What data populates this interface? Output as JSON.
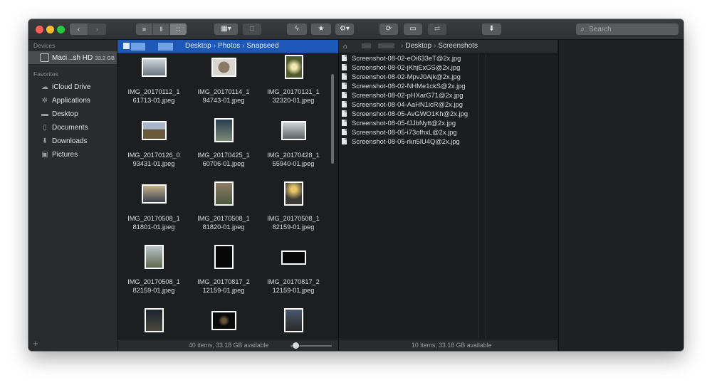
{
  "colors": {
    "close": "#fc5f57",
    "minimize": "#fdbc2e",
    "zoom": "#28c840",
    "path_bar_active": "#1d57b8"
  },
  "toolbar": {
    "back_icon": "chevron-left-icon",
    "forward_icon": "chevron-right-icon",
    "view_modes": [
      "list-view-icon",
      "column-view-icon",
      "icon-view-icon"
    ],
    "active_view": "icon-view-icon",
    "icons": [
      "arrange-icon",
      "get-info-icon",
      "quick-action-icon",
      "favorite-star-icon",
      "gear-icon",
      "refresh-icon",
      "terminal-icon",
      "compare-icon",
      "download-icon"
    ],
    "search_placeholder": "Search"
  },
  "sidebar": {
    "devices_heading": "Devices",
    "device": {
      "name": "Maci...sh HD",
      "capacity": "33.2 GB"
    },
    "favorites_heading": "Favorites",
    "favorites": [
      {
        "label": "iCloud Drive",
        "icon": "cloud-icon"
      },
      {
        "label": "Applications",
        "icon": "applications-icon"
      },
      {
        "label": "Desktop",
        "icon": "desktop-icon"
      },
      {
        "label": "Documents",
        "icon": "document-icon"
      },
      {
        "label": "Downloads",
        "icon": "download-icon"
      },
      {
        "label": "Pictures",
        "icon": "camera-icon"
      }
    ],
    "add_label": "+"
  },
  "pane_left": {
    "breadcrumbs": [
      "Desktop",
      "Photos",
      "Snapseed"
    ],
    "files": [
      {
        "line1": "IMG_20170112_1",
        "line2": "61713-01.jpeg"
      },
      {
        "line1": "IMG_20170114_1",
        "line2": "94743-01.jpeg"
      },
      {
        "line1": "IMG_20170121_1",
        "line2": "32320-01.jpeg"
      },
      {
        "line1": "IMG_20170126_0",
        "line2": "93431-01.jpeg"
      },
      {
        "line1": "IMG_20170425_1",
        "line2": "60706-01.jpeg"
      },
      {
        "line1": "IMG_20170428_1",
        "line2": "55940-01.jpeg"
      },
      {
        "line1": "IMG_20170508_1",
        "line2": "81801-01.jpeg"
      },
      {
        "line1": "IMG_20170508_1",
        "line2": "81820-01.jpeg"
      },
      {
        "line1": "IMG_20170508_1",
        "line2": "82159-01.jpeg"
      },
      {
        "line1": "IMG_20170508_1",
        "line2": "82159-01.jpeg"
      },
      {
        "line1": "IMG_20170817_2",
        "line2": "12159-01.jpeg"
      },
      {
        "line1": "IMG_20170817_2",
        "line2": "12159-01.jpeg"
      },
      {
        "line1": "",
        "line2": ""
      },
      {
        "line1": "",
        "line2": ""
      },
      {
        "line1": "",
        "line2": ""
      }
    ],
    "status": "40 items, 33.18 GB available"
  },
  "pane_right": {
    "breadcrumbs": [
      "Desktop",
      "Screenshots"
    ],
    "files": [
      "Screenshot-08-02-eOi633eT@2x.jpg",
      "Screenshot-08-02-jKhjExGS@2x.jpg",
      "Screenshot-08-02-MpvJ0Ajk@2x.jpg",
      "Screenshot-08-02-NHMe1ckS@2x.jpg",
      "Screenshot-08-02-pHXarG71@2x.jpg",
      "Screenshot-08-04-AaHN1icR@2x.jpg",
      "Screenshot-08-05-AvGWO1Kh@2x.jpg",
      "Screenshot-08-05-fJJbNytt@2x.jpg",
      "Screenshot-08-05-i73ofhxL@2x.jpg",
      "Screenshot-08-05-rkn5lU4Q@2x.jpg"
    ],
    "status": "10 items, 33.18 GB available"
  }
}
